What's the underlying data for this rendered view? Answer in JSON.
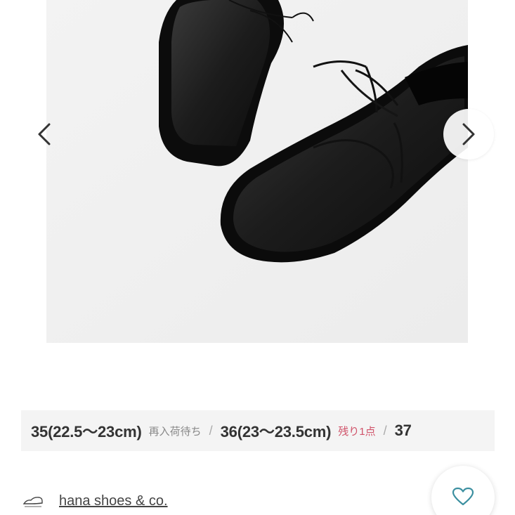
{
  "gallery": {
    "image_alt": "black leather lace-up shoes",
    "prev_icon": "chevron-left-icon",
    "next_icon": "chevron-right-icon"
  },
  "sizes": [
    {
      "label": "35(22.5〜23cm)",
      "status": "再入荷待ち",
      "status_color": "#888888"
    },
    {
      "label": "36(23〜23.5cm)",
      "status": "残り1点",
      "status_color": "#d0536a"
    },
    {
      "label": "37",
      "status": "",
      "status_color": "#888888"
    }
  ],
  "size_separator": "/",
  "brand": {
    "name": "hana shoes & co.",
    "logo_icon": "shoe-logo-icon"
  },
  "favorite": {
    "icon": "heart-icon",
    "color": "#3b8fa0"
  }
}
